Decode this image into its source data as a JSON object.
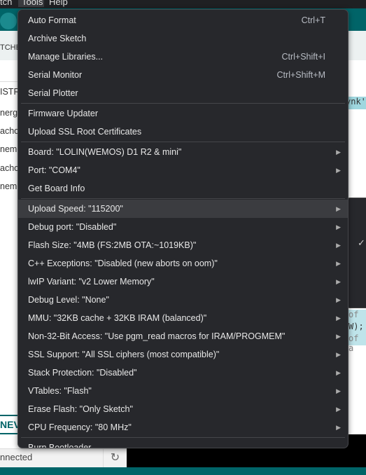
{
  "menubar": {
    "items": [
      "tch",
      "Tools",
      "Help"
    ]
  },
  "sidebar": {
    "header": "TCHE",
    "section": "ISTR",
    "items": [
      "nerg",
      "acho",
      "neme",
      "acho",
      "neme"
    ],
    "tab": "NEV"
  },
  "editor": {
    "lines": [
      "ynk'",
      "of a",
      "W);",
      "of a"
    ]
  },
  "status": {
    "connection": "nnected"
  },
  "tools_menu": {
    "groups": [
      [
        {
          "label": "Auto Format",
          "shortcut": "Ctrl+T"
        },
        {
          "label": "Archive Sketch"
        },
        {
          "label": "Manage Libraries...",
          "shortcut": "Ctrl+Shift+I"
        },
        {
          "label": "Serial Monitor",
          "shortcut": "Ctrl+Shift+M"
        },
        {
          "label": "Serial Plotter"
        }
      ],
      [
        {
          "label": "Firmware Updater"
        },
        {
          "label": "Upload SSL Root Certificates"
        }
      ],
      [
        {
          "label": "Board: \"LOLIN(WEMOS) D1 R2 & mini\"",
          "submenu": true
        },
        {
          "label": "Port: \"COM4\"",
          "submenu": true
        },
        {
          "label": "Get Board Info"
        }
      ],
      [
        {
          "label": "Upload Speed: \"115200\"",
          "submenu": true,
          "highlighted": true
        },
        {
          "label": "Debug port: \"Disabled\"",
          "submenu": true
        },
        {
          "label": "Flash Size: \"4MB (FS:2MB OTA:~1019KB)\"",
          "submenu": true
        },
        {
          "label": "C++ Exceptions: \"Disabled (new aborts on oom)\"",
          "submenu": true
        },
        {
          "label": "lwIP Variant: \"v2 Lower Memory\"",
          "submenu": true
        },
        {
          "label": "Debug Level: \"None\"",
          "submenu": true
        },
        {
          "label": "MMU: \"32KB cache + 32KB IRAM (balanced)\"",
          "submenu": true
        },
        {
          "label": "Non-32-Bit Access: \"Use pgm_read macros for IRAM/PROGMEM\"",
          "submenu": true
        },
        {
          "label": "SSL Support: \"All SSL ciphers (most compatible)\"",
          "submenu": true
        },
        {
          "label": "Stack Protection: \"Disabled\"",
          "submenu": true
        },
        {
          "label": "VTables: \"Flash\"",
          "submenu": true
        },
        {
          "label": "Erase Flash: \"Only Sketch\"",
          "submenu": true
        },
        {
          "label": "CPU Frequency: \"80 MHz\"",
          "submenu": true
        }
      ],
      [
        {
          "label": "Burn Bootloader"
        }
      ]
    ]
  },
  "submenu": {
    "checked_icon": "checkmark-icon"
  }
}
